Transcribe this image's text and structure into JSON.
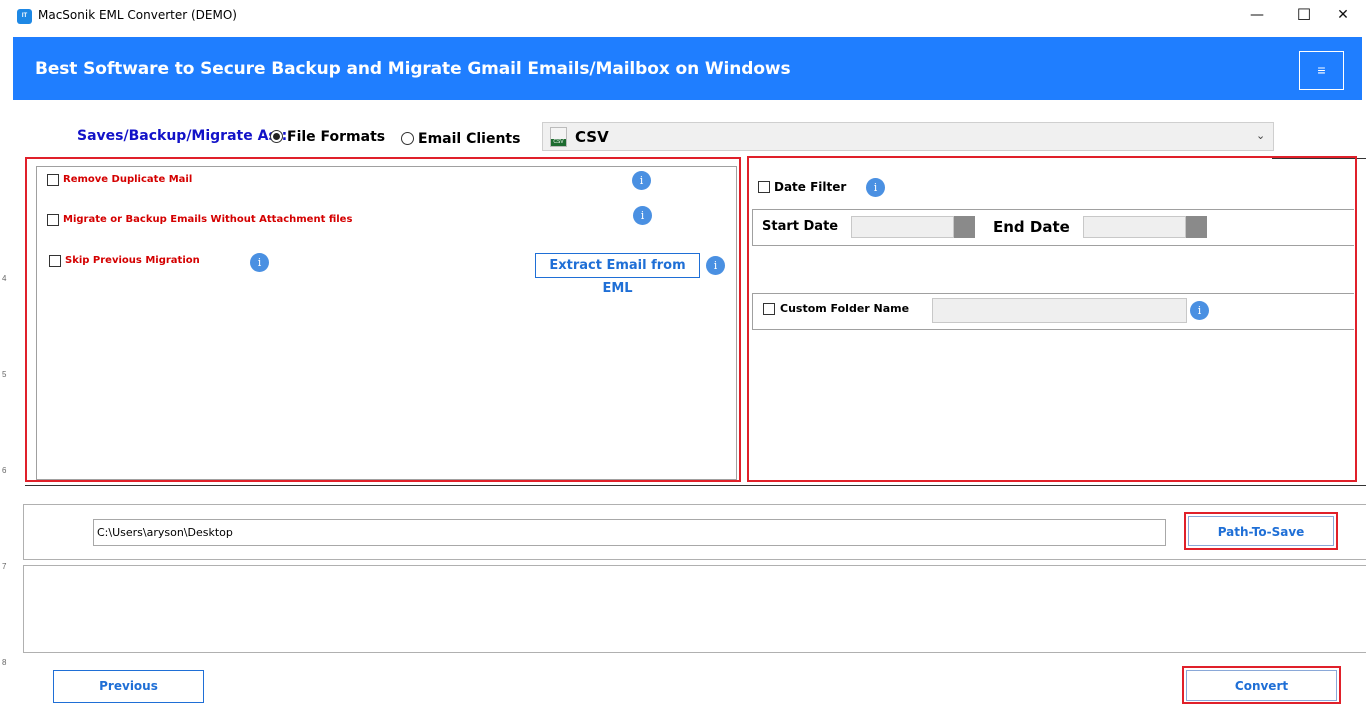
{
  "window": {
    "app_icon_text": "IT",
    "title": "MacSonik EML Converter (DEMO)",
    "minimize": "—",
    "maximize": "☐",
    "close": "✕"
  },
  "header": {
    "title": "Best Software to Secure Backup and Migrate Gmail Emails/Mailbox on Windows",
    "menu_icon": "≡"
  },
  "save_as": {
    "label": "Saves/Backup/Migrate As :",
    "options": [
      "File Formats",
      "Email Clients"
    ],
    "selected": "File Formats",
    "format_selected": "CSV",
    "format_icon_tag": "CSV"
  },
  "left_panel": {
    "options": [
      {
        "label": "Remove Duplicate Mail",
        "checked": false
      },
      {
        "label": "Migrate or Backup Emails Without Attachment files",
        "checked": false
      },
      {
        "label": "Skip Previous Migration",
        "checked": false
      }
    ],
    "extract_button": "Extract Email from EML",
    "info_glyph": "i"
  },
  "right_panel": {
    "date_filter_label": "Date Filter",
    "start_date_label": "Start Date",
    "end_date_label": "End Date",
    "start_date_value": "",
    "end_date_value": "",
    "custom_folder_label": "Custom Folder Name",
    "custom_folder_value": ""
  },
  "path": {
    "value": "C:\\Users\\aryson\\Desktop",
    "button": "Path-To-Save"
  },
  "footer": {
    "previous": "Previous",
    "convert": "Convert"
  },
  "ruler": [
    "4",
    "5",
    "6",
    "7",
    "8"
  ],
  "colors": {
    "header_bg": "#1f7eff",
    "highlight_red": "#e0202a",
    "option_red": "#d40000",
    "accent_blue": "#1f6fd6",
    "saveas_label": "#1212c8"
  }
}
